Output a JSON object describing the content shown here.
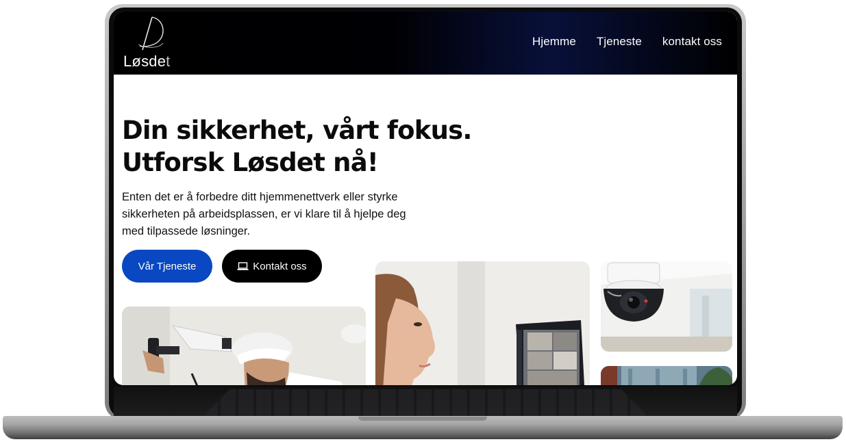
{
  "brand": {
    "logo_text_main": "Løsde",
    "logo_text_fade": "t"
  },
  "nav": {
    "items": [
      {
        "label": "Hjemme"
      },
      {
        "label": "Tjeneste"
      },
      {
        "label": "kontakt oss"
      }
    ]
  },
  "hero": {
    "title": "Din sikkerhet, vårt fokus. Utforsk Løsdet nå!",
    "description": "Enten det er å forbedre ditt hjemmenettverk eller styrke sikkerheten på arbeidsplassen, er vi klare til å hjelpe deg med tilpassede løsninger.",
    "primary_button": "Vår Tjeneste",
    "secondary_button": "Kontakt oss",
    "secondary_button_icon": "laptop-icon"
  },
  "colors": {
    "primary_button": "#0a47c2",
    "secondary_button": "#000000",
    "header_bg": "#000000",
    "header_accent": "#08103a"
  },
  "images": [
    {
      "name": "technician-installing-camera"
    },
    {
      "name": "woman-viewing-camera-feed-laptop"
    },
    {
      "name": "dome-security-camera"
    },
    {
      "name": "interior-room-photo"
    }
  ]
}
